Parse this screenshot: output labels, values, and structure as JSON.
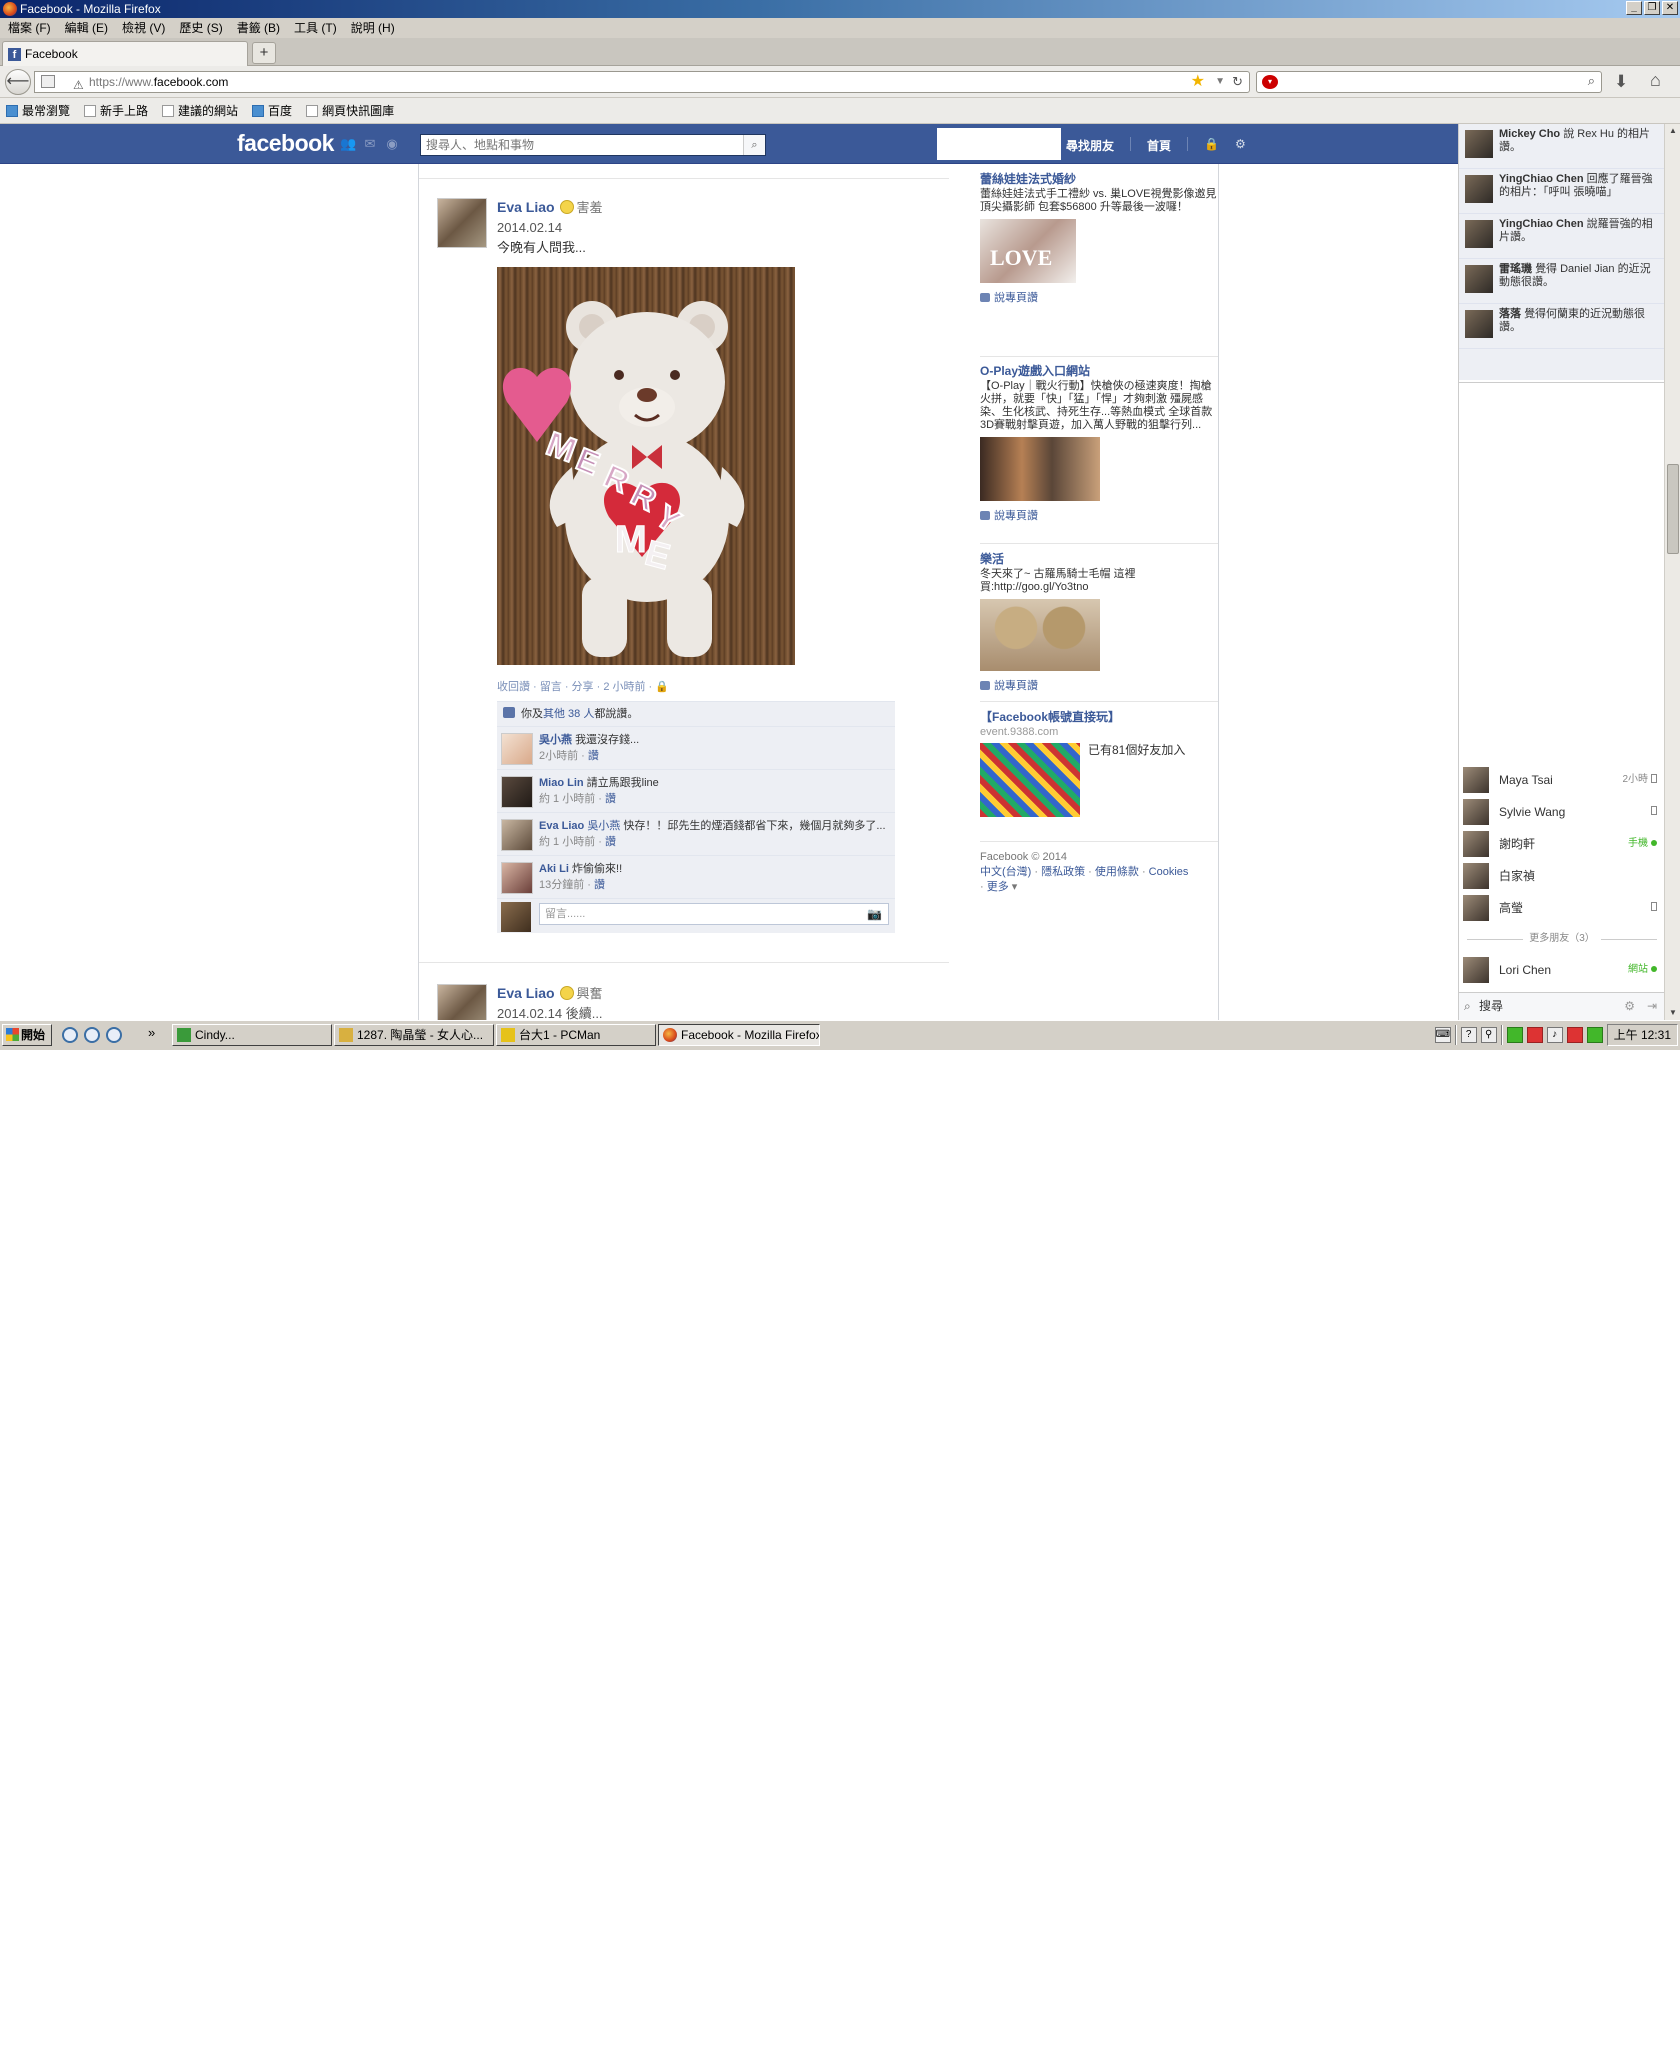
{
  "window": {
    "title": "Facebook - Mozilla Firefox",
    "controls": [
      "_",
      "❐",
      "✕"
    ]
  },
  "menubar": [
    "檔案 (F)",
    "編輯 (E)",
    "檢視 (V)",
    "歷史 (S)",
    "書籤 (B)",
    "工具 (T)",
    "說明 (H)"
  ],
  "tab": {
    "title": "Facebook",
    "new_tab": "+"
  },
  "url": {
    "prefix": "https://www.",
    "domain": "facebook.com"
  },
  "bookmarks": [
    {
      "label": "最常瀏覽",
      "icon": "globe-icon"
    },
    {
      "label": "新手上路",
      "icon": "page-icon"
    },
    {
      "label": "建議的網站",
      "icon": "page-icon"
    },
    {
      "label": "百度",
      "icon": "baidu-icon"
    },
    {
      "label": "網頁快訊圖庫",
      "icon": "page-icon"
    }
  ],
  "fb": {
    "logo": "facebook",
    "search_placeholder": "搜尋人、地點和事物",
    "nav": {
      "find_friends": "尋找朋友",
      "home": "首頁"
    }
  },
  "posts": [
    {
      "author": "Eva Liao",
      "feeling": "害羞",
      "date": "2014.02.14",
      "text": "今晚有人問我...",
      "photo_text": [
        "M",
        "E",
        "R",
        "R",
        "Y",
        "M",
        "E"
      ],
      "actions": "收回讚 · 留言 · 分享 · 2 小時前 · 🔒",
      "likes": {
        "prefix": "你及",
        "link": "其他 38 人",
        "suffix": "都說讚。"
      },
      "comments": [
        {
          "name": "吳小燕",
          "text": "我還沒存錢...",
          "time": "2小時前",
          "like": "讚"
        },
        {
          "name": "Miao Lin",
          "text": "請立馬跟我line",
          "time": "約 1 小時前",
          "like": "讚"
        },
        {
          "name": "Eva Liao",
          "mention": "吳小燕",
          "text": "快存！！邱先生的煙酒錢都省下來，幾個月就夠多了...",
          "time": "約 1 小時前",
          "like": "讚"
        },
        {
          "name": "Aki Li",
          "text": "炸偷偷來!!",
          "time": "13分鐘前",
          "like": "讚"
        }
      ],
      "comment_placeholder": "留言......"
    },
    {
      "author": "Eva Liao",
      "feeling": "興奮",
      "date": "2014.02.14",
      "text": "後續..."
    }
  ],
  "ads": [
    {
      "title": "蕾絲娃娃法式婚紗",
      "text": "蕾絲娃娃法式手工禮紗 vs. 巢LOVE視覺影像邀見頂尖攝影師 包套$56800 升等最後一波囉！",
      "img_text": "LOVE",
      "like": "說專頁讚"
    },
    {
      "title": "O-Play遊戲入口網站",
      "text": "【O-Play｜戰火行動】快槍俠の極速爽度！掏槍火拼，就要「快」「猛」「悍」才夠刺激 殭屍感染、生化核武、持死生存...等熱血模式 全球首款3D賽戰射擊頁遊，加入萬人野戰的狙擊行列...",
      "like": "說專頁讚"
    },
    {
      "title": "樂活",
      "text": "冬天來了~ 古羅馬騎士毛帽 這裡買:http://goo.gl/Yo3tno",
      "like": "說專頁讚"
    },
    {
      "title": "【Facebook帳號直接玩】",
      "domain": "event.9388.com",
      "side_text": "已有81個好友加入"
    }
  ],
  "footer": {
    "copyright": "Facebook © 2014",
    "links": [
      "中文(台灣)",
      "隱私政策",
      "使用條款",
      "Cookies",
      "更多"
    ]
  },
  "ticker": [
    {
      "name": "Mickey Cho",
      "text": "說 Rex Hu 的相片讚。"
    },
    {
      "name": "YingChiao Chen",
      "text": "回應了羅晉強的相片：「呼叫 張曉喵」"
    },
    {
      "name": "YingChiao Chen",
      "text": "說羅晉強的相片讚。"
    },
    {
      "name": "雷瑤璣",
      "text": "覺得 Daniel Jian 的近況動態很讚。"
    },
    {
      "name": "落落",
      "text": "覺得何蘭東的近況動態很讚。"
    }
  ],
  "chat": {
    "friends": [
      {
        "name": "Maya Tsai",
        "status": "2小時",
        "mode": "phone"
      },
      {
        "name": "Sylvie Wang",
        "status": "",
        "mode": "phone"
      },
      {
        "name": "謝昀軒",
        "status": "手機",
        "mode": "online"
      },
      {
        "name": "白家禎",
        "status": "",
        "mode": "none"
      },
      {
        "name": "高瑩",
        "status": "",
        "mode": "phone"
      }
    ],
    "more_friends": "更多朋友（3）",
    "more": [
      {
        "name": "Lori Chen",
        "status": "網站",
        "mode": "online"
      }
    ],
    "search": "搜尋"
  },
  "taskbar": {
    "start": "開始",
    "tasks": [
      "Cindy...",
      "1287. 陶晶瑩 - 女人心...",
      "台大1 - PCMan",
      "Facebook - Mozilla Firefox"
    ],
    "time": "上午 12:31"
  },
  "colors": {
    "fb_blue": "#3b5998",
    "link_blue": "#3b5998",
    "online_green": "#42b72a"
  }
}
